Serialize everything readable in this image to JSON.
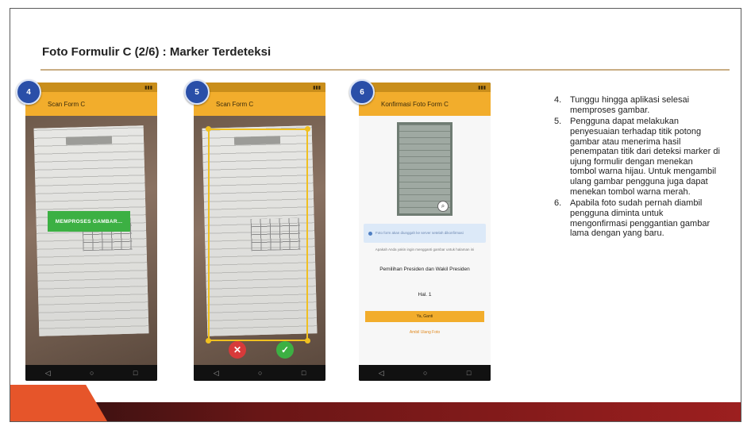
{
  "slide": {
    "title": "Foto Formulir C (2/6) : Marker Terdeteksi"
  },
  "phone4": {
    "badge": "4",
    "app_title": "Scan Form C",
    "toast": "MEMPROSES GAMBAR..."
  },
  "phone5": {
    "badge": "5",
    "app_title": "Scan Form C"
  },
  "phone6": {
    "badge": "6",
    "app_title": "Konfirmasi Foto Form C",
    "info": "Foto form akan diunggah ke server setelah dikonfirmasi",
    "prompt": "Apakah Anda yakin ingin mengganti gambar untuk halaman ini",
    "election": "Pemilihan Presiden dan Wakil Presiden",
    "page": "Hal. 1",
    "yes_label": "Ya, Ganti",
    "retake_label": "Ambil Ulang Foto"
  },
  "instructions": [
    {
      "num": "4.",
      "text": "Tunggu hingga aplikasi selesai memproses gambar."
    },
    {
      "num": "5.",
      "text": "Pengguna dapat melakukan penyesuaian terhadap titik potong gambar atau menerima hasil penempatan titik dari deteksi marker di ujung formulir dengan menekan tombol warna hijau. Untuk mengambil ulang gambar pengguna juga dapat menekan tombol warna merah."
    },
    {
      "num": "6.",
      "text": "Apabila foto sudah pernah diambil pengguna diminta untuk mengonfirmasi penggantian gambar lama dengan yang baru."
    }
  ],
  "colors": {
    "accent": "#f2ad2c",
    "badge": "#2a4fa8",
    "accept": "#3cb043",
    "reject": "#d73a3a",
    "footer": "#9c1f1f"
  },
  "icons": {
    "back": "nav-back-icon",
    "home": "nav-home-icon",
    "recent": "nav-recent-icon",
    "zoom": "magnifier-icon",
    "accept": "check-icon",
    "reject": "close-icon"
  }
}
